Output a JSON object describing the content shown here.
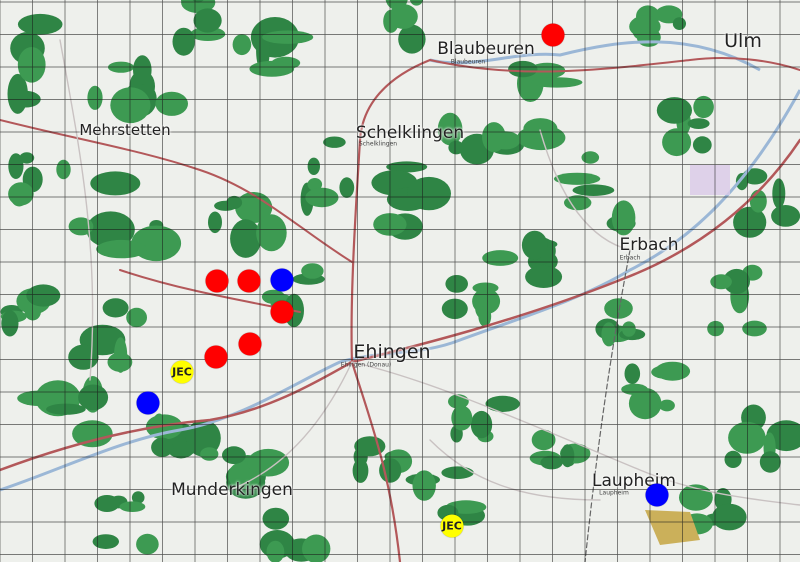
{
  "map": {
    "colors": {
      "land": "#eef0ec",
      "forest": "#3d9a52",
      "forest_dark": "#2f8545",
      "road_major": "#b3585a",
      "road_minor": "#c7c7c7",
      "river": "#9bb7d6",
      "grid": "#1a1a1a",
      "marker_red": "#ff0000",
      "marker_blue": "#0000ff",
      "marker_yellow": "#ffff00"
    },
    "places": [
      {
        "id": "blaubeuren",
        "name": "Blaubeuren",
        "subname": "Blaubeuren"
      },
      {
        "id": "ulm",
        "name": "Ulm",
        "subname": ""
      },
      {
        "id": "mehrstetten",
        "name": "Mehrstetten",
        "subname": ""
      },
      {
        "id": "schelklingen",
        "name": "Schelklingen",
        "subname": "Schelklingen"
      },
      {
        "id": "erbach",
        "name": "Erbach",
        "subname": "Erbach"
      },
      {
        "id": "ehingen",
        "name": "Ehingen",
        "subname": "Ehingen (Donau)"
      },
      {
        "id": "munderkingen",
        "name": "Munderkingen",
        "subname": ""
      },
      {
        "id": "laupheim",
        "name": "Laupheim",
        "subname": "Laupheim"
      }
    ],
    "markers": [
      {
        "id": "red-blaubeuren",
        "color": "red",
        "label": ""
      },
      {
        "id": "red-1",
        "color": "red",
        "label": ""
      },
      {
        "id": "red-2",
        "color": "red",
        "label": ""
      },
      {
        "id": "blue-1",
        "color": "blue",
        "label": ""
      },
      {
        "id": "red-3",
        "color": "red",
        "label": ""
      },
      {
        "id": "red-4",
        "color": "red",
        "label": ""
      },
      {
        "id": "red-5",
        "color": "red",
        "label": ""
      },
      {
        "id": "yellow-west",
        "color": "yellow",
        "label": "JEC"
      },
      {
        "id": "blue-west",
        "color": "blue",
        "label": ""
      },
      {
        "id": "yellow-south",
        "color": "yellow",
        "label": "JEC"
      },
      {
        "id": "blue-laupheim",
        "color": "blue",
        "label": ""
      }
    ]
  }
}
